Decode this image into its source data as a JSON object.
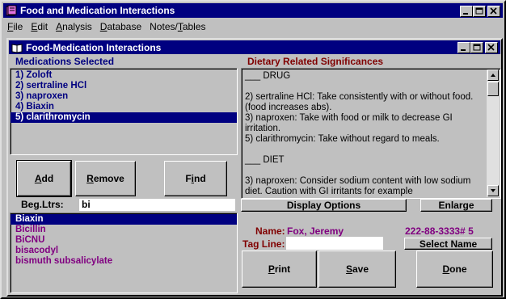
{
  "app": {
    "title": "Food and Medication Interactions",
    "menu": [
      "File",
      "Edit",
      "Analysis",
      "Database",
      "Notes/Tables"
    ]
  },
  "child": {
    "title": "Food-Medication Interactions"
  },
  "medications": {
    "label": "Medications Selected",
    "items": [
      "1) Zoloft",
      "2)  sertraline HCl",
      "3)  naproxen",
      "4) Biaxin",
      "5)  clarithromycin"
    ],
    "selected_index": 4
  },
  "buttons": {
    "add": "Add",
    "remove": "Remove",
    "find": "Find",
    "display_options": "Display Options",
    "enlarge": "Enlarge",
    "select_name": "Select Name",
    "print": "Print",
    "save": "Save",
    "done": "Done"
  },
  "search": {
    "label": "Beg.Ltrs:",
    "value": "bi"
  },
  "results": {
    "items": [
      "Biaxin",
      "Bicillin",
      "BiCNU",
      "bisacodyl",
      "bismuth subsalicylate"
    ],
    "selected_index": 0
  },
  "dietary": {
    "label": "Dietary Related Significances",
    "paragraphs": [
      "___ DRUG",
      "",
      "2) sertraline HCl: Take consistently with or without food. (food increases abs).",
      "3) naproxen: Take with food or milk to decrease GI irritation.",
      "5) clarithromycin: Take without regard to meals.",
      "",
      "___ DIET",
      "",
      "3) naproxen: Consider sodium content with low sodium diet. Caution with GI irritants for example"
    ]
  },
  "patient": {
    "name_label": "Name:",
    "name_value": "Fox, Jeremy",
    "id_value": "222-88-3333# 5",
    "tagline_label": "Tag Line:",
    "tagline_value": ""
  },
  "colors": {
    "titlebar": "#000080",
    "label_navy": "#000080",
    "label_maroon": "#800000",
    "text_purple": "#800080",
    "face": "#c0c0c0"
  }
}
